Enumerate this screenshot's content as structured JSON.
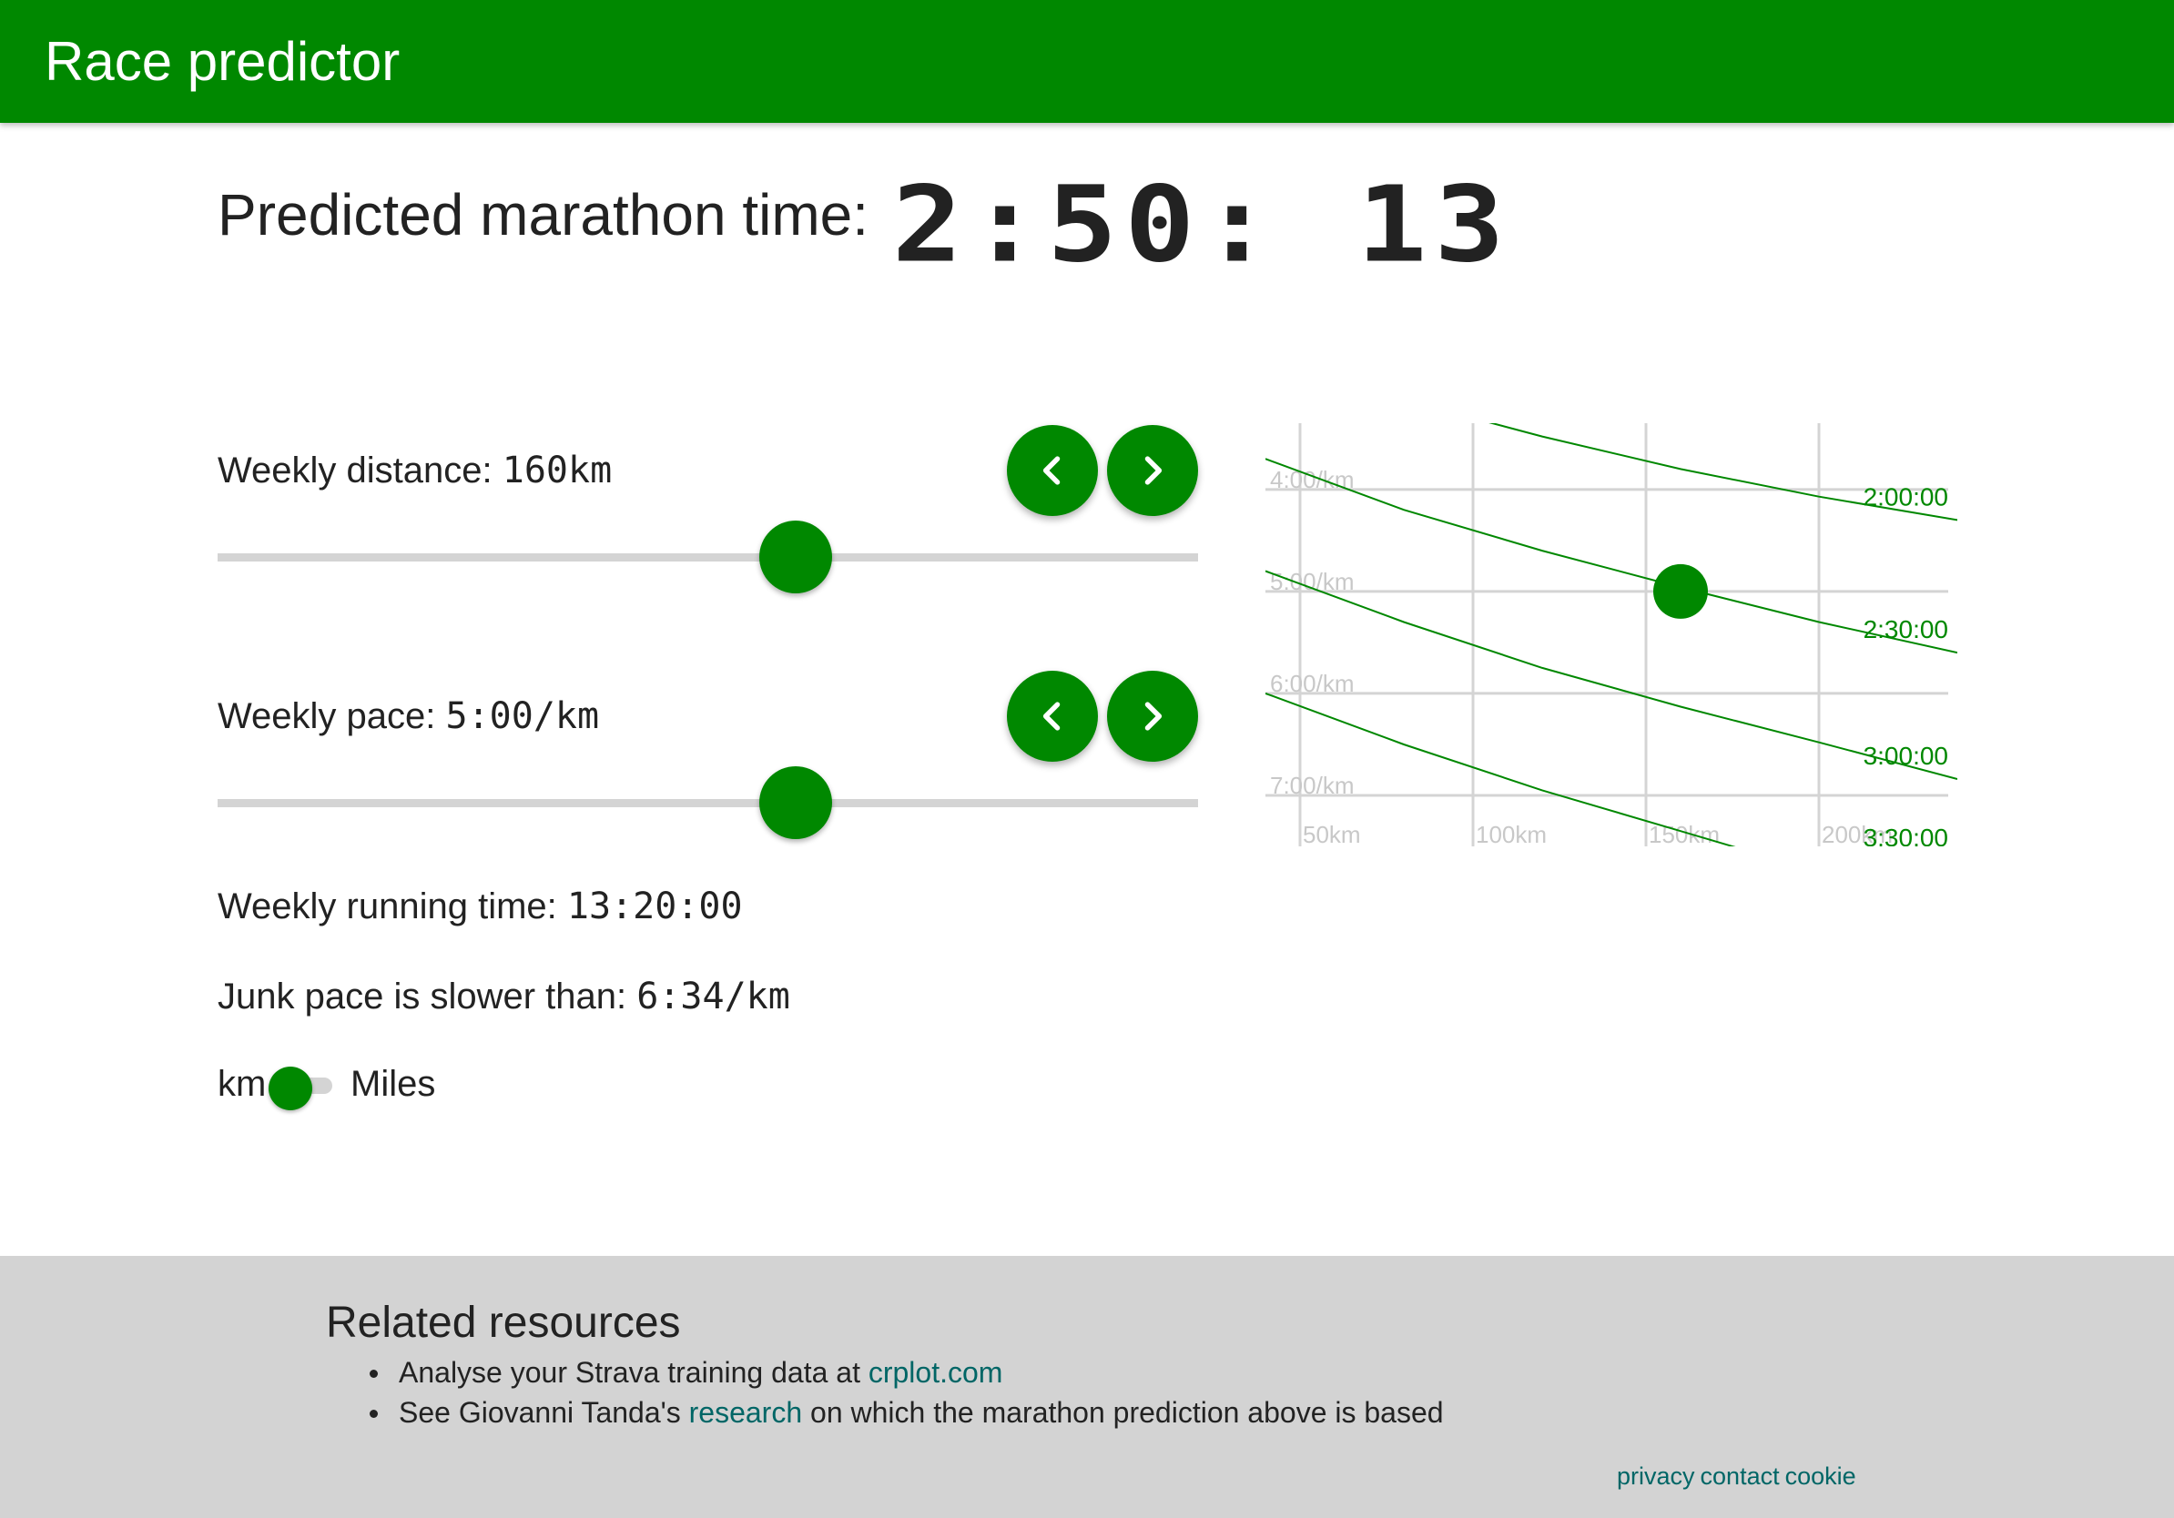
{
  "app": {
    "title": "Race predictor"
  },
  "prediction": {
    "label": "Predicted marathon time:",
    "value": "2:50: 13"
  },
  "distance": {
    "label": "Weekly distance:",
    "value": "160km",
    "level": 0.59
  },
  "pace": {
    "label": "Weekly pace:",
    "value": "5:00/km",
    "level": 0.59
  },
  "running_time": {
    "label": "Weekly running time:",
    "value": "13:20:00"
  },
  "junk_pace": {
    "label": "Junk pace is slower than:",
    "value": "6:34/km"
  },
  "units": {
    "left": "km",
    "right": "Miles",
    "selected": "km"
  },
  "icons": {
    "prev": "chevron-left-icon",
    "next": "chevron-right-icon"
  },
  "colors": {
    "accent": "#008800",
    "link": "#006666",
    "footer_bg": "#d3d3d3",
    "grid": "#d4d4d4"
  },
  "chart_data": {
    "type": "line",
    "x_tick_labels": [
      "50km",
      "100km",
      "150km",
      "200km"
    ],
    "x_ticks": [
      50,
      100,
      150,
      200
    ],
    "y_tick_labels": [
      "4:00/km",
      "5:00/km",
      "6:00/km",
      "7:00/km"
    ],
    "y_ticks": [
      4,
      5,
      6,
      7
    ],
    "xlim": [
      40,
      240
    ],
    "ylim": [
      3.35,
      7.5
    ],
    "series": [
      {
        "name": "2:00:00",
        "x": [
          40,
          80,
          120,
          160,
          200,
          240
        ],
        "y": [
          2.7,
          3.12,
          3.48,
          3.8,
          4.07,
          4.3
        ]
      },
      {
        "name": "2:30:00",
        "x": [
          40,
          80,
          120,
          160,
          200,
          240
        ],
        "y": [
          3.7,
          4.2,
          4.6,
          4.96,
          5.3,
          5.6
        ]
      },
      {
        "name": "3:00:00",
        "x": [
          40,
          80,
          120,
          160,
          200,
          240
        ],
        "y": [
          4.8,
          5.3,
          5.75,
          6.13,
          6.48,
          6.84
        ]
      },
      {
        "name": "3:30:00",
        "x": [
          40,
          80,
          120,
          160,
          200,
          240
        ],
        "y": [
          6.0,
          6.5,
          6.95,
          7.35,
          7.75,
          8.1
        ]
      }
    ],
    "current_point": {
      "x": 160,
      "y": 5.0
    },
    "grid": true
  },
  "footer": {
    "title": "Related resources",
    "items": [
      {
        "before": "Analyse your Strava training data at ",
        "link": "crplot.com",
        "after": ""
      },
      {
        "before": "See Giovanni Tanda's ",
        "link": "research",
        "after": " on which the marathon prediction above is based"
      }
    ],
    "links": [
      "privacy",
      "contact",
      "cookie"
    ]
  }
}
